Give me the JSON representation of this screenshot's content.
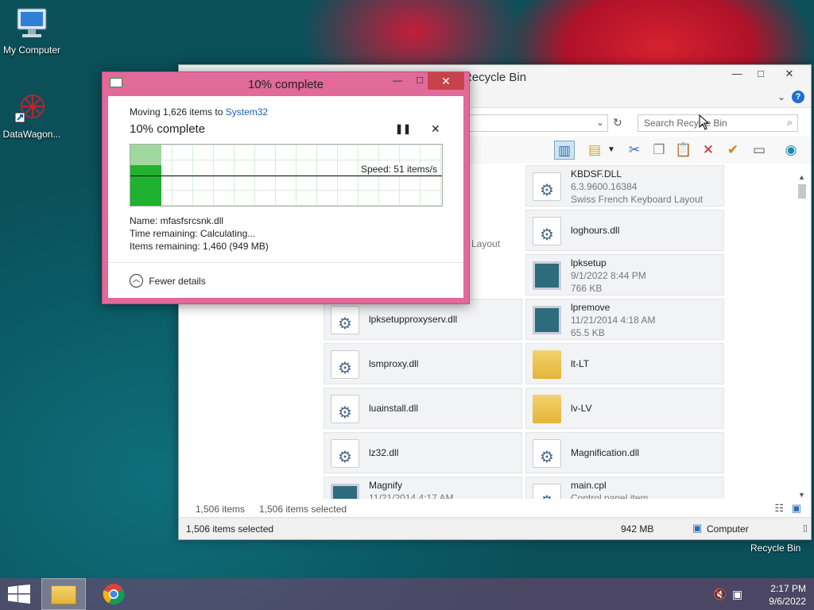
{
  "desktop": {
    "icons": [
      {
        "label": "My Computer"
      },
      {
        "label": "DataWagon..."
      }
    ],
    "recycle_bin_caption": "Recycle Bin"
  },
  "explorer": {
    "title": "Recycle Bin",
    "controls": {
      "minimize": "—",
      "maximize": "□",
      "close": "✕"
    },
    "search_placeholder": "Search Recycle Bin",
    "items": [
      {
        "name": "KBDSF.DLL",
        "sub1": "6.3.9600.16384",
        "sub2": "Swiss French Keyboard Layout",
        "icon": "dll"
      },
      {
        "name": "loghours.dll",
        "icon": "dll"
      },
      {
        "name": "lpksetup",
        "sub1": "9/1/2022 8:44 PM",
        "sub2": "766 KB",
        "icon": "exe"
      },
      {
        "name": "lpremove",
        "sub1": "11/21/2014 4:18 AM",
        "sub2": "65.5 KB",
        "icon": "exe"
      },
      {
        "name": "lt-LT",
        "icon": "folder"
      },
      {
        "name": "lv-LV",
        "icon": "folder"
      },
      {
        "name": "Magnification.dll",
        "icon": "dll"
      },
      {
        "name": "main.cpl",
        "sub1": "Control panel item",
        "icon": "dll"
      },
      {
        "name": "lpksetupproxyserv.dll",
        "icon": "dll"
      },
      {
        "name": "lsmproxy.dll",
        "icon": "dll"
      },
      {
        "name": "luainstall.dll",
        "icon": "dll"
      },
      {
        "name": "lz32.dll",
        "icon": "dll"
      },
      {
        "name": "Magnify",
        "sub1": "11/21/2014 4:17 AM",
        "icon": "exe"
      }
    ],
    "partial_text": "Layout",
    "status": {
      "count": "1,506 items",
      "selected": "1,506 items selected"
    },
    "bottom": {
      "selected": "1,506 items selected",
      "size": "942 MB",
      "location": "Computer"
    }
  },
  "dialog": {
    "title": "10% complete",
    "moving_prefix": "Moving 1,626 items to",
    "destination": "System32",
    "heading": "10% complete",
    "speed": "Speed: 51 items/s",
    "name": "Name: mfasfsrcsnk.dll",
    "time_remaining": "Time remaining: Calculating...",
    "items_remaining": "Items remaining: 1,460 (949 MB)",
    "fewer_details": "Fewer details",
    "progress": 0.1
  },
  "taskbar": {
    "time": "2:17 PM",
    "date": "9/6/2022"
  }
}
